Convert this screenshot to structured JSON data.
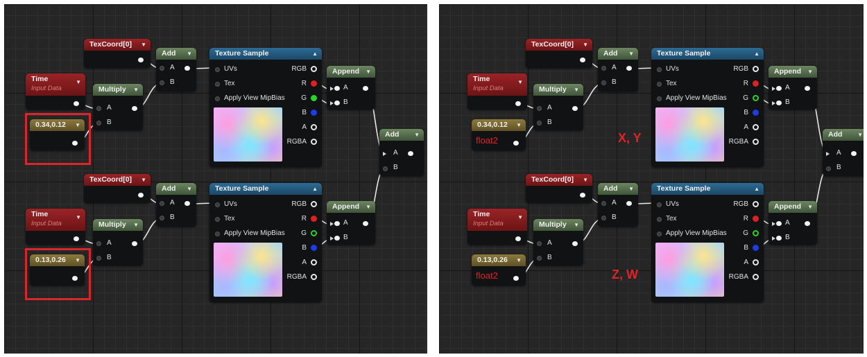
{
  "panels": [
    {
      "id": "left",
      "graphs": [
        {
          "texcoord": "TexCoord[0]",
          "add": "Add",
          "add_a": "A",
          "add_b": "B",
          "time_title": "Time",
          "time_sub": "Input Data",
          "multiply": "Multiply",
          "mul_a": "A",
          "mul_b": "B",
          "const_value": "0.34,0.12",
          "const_label": "",
          "texture_title": "Texture Sample",
          "uvs": "UVs",
          "tex": "Tex",
          "mip": "Apply View MipBias",
          "out_rgb": "RGB",
          "out_r": "R",
          "out_g": "G",
          "out_b": "B",
          "out_a": "A",
          "out_rgba": "RGBA",
          "append": "Append",
          "append_a": "A",
          "append_b": "B"
        },
        {
          "texcoord": "TexCoord[0]",
          "add": "Add",
          "add_a": "A",
          "add_b": "B",
          "time_title": "Time",
          "time_sub": "Input Data",
          "multiply": "Multiply",
          "mul_a": "A",
          "mul_b": "B",
          "const_value": "0.13,0.26",
          "const_label": "",
          "texture_title": "Texture Sample",
          "uvs": "UVs",
          "tex": "Tex",
          "mip": "Apply View MipBias",
          "out_rgb": "RGB",
          "out_r": "R",
          "out_g": "G",
          "out_b": "B",
          "out_a": "A",
          "out_rgba": "RGBA",
          "append": "Append",
          "append_a": "A",
          "append_b": "B"
        }
      ],
      "final_add": {
        "title": "Add",
        "a": "A",
        "b": "B"
      },
      "annotations": []
    },
    {
      "id": "right",
      "graphs": [
        {
          "texcoord": "TexCoord[0]",
          "add": "Add",
          "add_a": "A",
          "add_b": "B",
          "time_title": "Time",
          "time_sub": "Input Data",
          "multiply": "Multiply",
          "mul_a": "A",
          "mul_b": "B",
          "const_value": "0.34,0.12",
          "const_label": "float2",
          "texture_title": "Texture Sample",
          "uvs": "UVs",
          "tex": "Tex",
          "mip": "Apply View MipBias",
          "out_rgb": "RGB",
          "out_r": "R",
          "out_g": "G",
          "out_b": "B",
          "out_a": "A",
          "out_rgba": "RGBA",
          "append": "Append",
          "append_a": "A",
          "append_b": "B"
        },
        {
          "texcoord": "TexCoord[0]",
          "add": "Add",
          "add_a": "A",
          "add_b": "B",
          "time_title": "Time",
          "time_sub": "Input Data",
          "multiply": "Multiply",
          "mul_a": "A",
          "mul_b": "B",
          "const_value": "0.13,0.26",
          "const_label": "float2",
          "texture_title": "Texture Sample",
          "uvs": "UVs",
          "tex": "Tex",
          "mip": "Apply View MipBias",
          "out_rgb": "RGB",
          "out_r": "R",
          "out_g": "G",
          "out_b": "B",
          "out_a": "A",
          "out_rgba": "RGBA",
          "append": "Append",
          "append_a": "A",
          "append_b": "B"
        }
      ],
      "final_add": {
        "title": "Add",
        "a": "A",
        "b": "B"
      },
      "annotations": [
        "X, Y",
        "Z, W"
      ]
    }
  ],
  "colors": {
    "highlight": "#d8262c",
    "annotation": "#e02328",
    "pin_red": "#e02020",
    "pin_green": "#29d42c",
    "pin_blue": "#1e3be8"
  }
}
